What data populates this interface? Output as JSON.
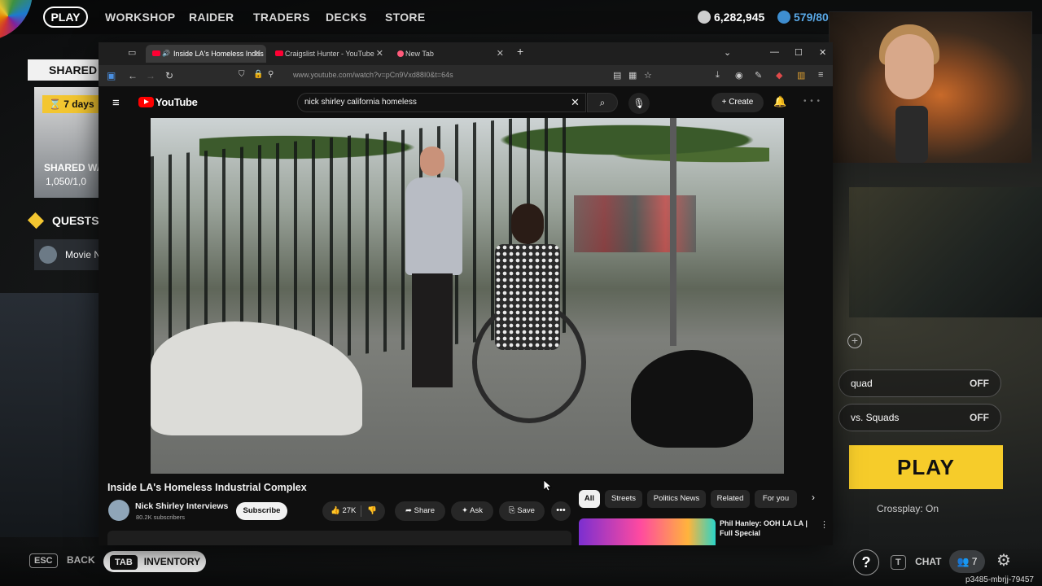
{
  "game": {
    "nav": {
      "play": "PLAY",
      "items": [
        "WORKSHOP",
        "RAIDER",
        "TRADERS",
        "DECKS",
        "STORE"
      ]
    },
    "currency": {
      "credits": "6,282,945",
      "tokens": "579/80"
    },
    "shared": {
      "title": "SHARED W",
      "days": "7 days",
      "name": "SHARED WA",
      "value": "1,050/1,0"
    },
    "quests": {
      "title": "QUESTS",
      "item": "Movie N"
    },
    "right_panel": {
      "toggle1_label": "quad",
      "toggle1_state": "OFF",
      "toggle2_label": "vs. Squads",
      "toggle2_state": "OFF",
      "play_label": "PLAY",
      "crossplay": "Crossplay: On"
    },
    "bottom": {
      "esc_key": "ESC",
      "back_label": "BACK",
      "tab_key": "TAB",
      "inventory_label": "INVENTORY",
      "help_label": "?",
      "chat_key": "T",
      "chat_label": "CHAT",
      "squad_count": "7",
      "user_id": "p3485-mbrjj-79457"
    }
  },
  "browser": {
    "tabs": [
      {
        "title": "Inside LA's Homeless Indus",
        "active": true
      },
      {
        "title": "Craigslist Hunter - YouTube",
        "active": false
      },
      {
        "title": "New Tab",
        "active": false
      }
    ],
    "new_tab_symbol": "+",
    "url": "www.youtube.com/watch?v=pCn9Vxd88I0&t=64s"
  },
  "youtube": {
    "logo_text": "YouTube",
    "search_query": "nick shirley california homeless",
    "create_label": "Create",
    "video": {
      "title": "Inside LA's Homeless Industrial Complex",
      "channel": "Nick Shirley Interviews",
      "subscribers": "80.2K subscribers",
      "subscribe_label": "Subscribe",
      "likes": "27K",
      "share_label": "Share",
      "ask_label": "Ask",
      "save_label": "Save"
    },
    "chips": [
      "All",
      "Streets",
      "Politics News",
      "Related",
      "For you"
    ],
    "recommendation": {
      "title": "Phil Hanley: OOH LA LA | Full Special"
    }
  },
  "colors": {
    "accent_yellow": "#f6cc2a",
    "youtube_red": "#ff0000"
  }
}
